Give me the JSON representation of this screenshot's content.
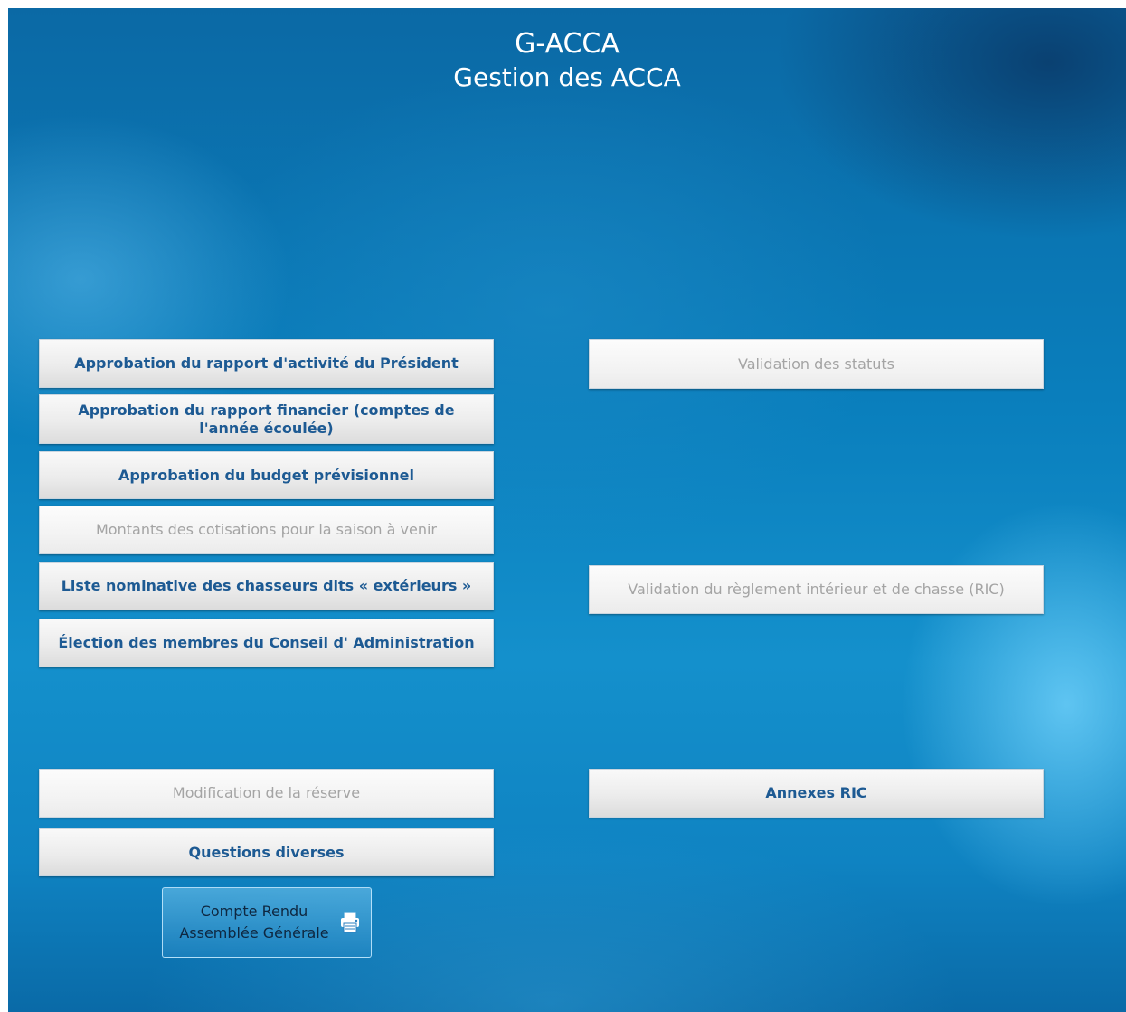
{
  "header": {
    "title": "G-ACCA",
    "subtitle": "Gestion des ACCA"
  },
  "left_buttons": [
    {
      "label": "Approbation du rapport d'activité du Président",
      "enabled": true
    },
    {
      "label": "Approbation du rapport financier (comptes de l'année écoulée)",
      "enabled": true
    },
    {
      "label": "Approbation du budget prévisionnel",
      "enabled": true
    },
    {
      "label": "Montants des cotisations pour la saison à venir",
      "enabled": false
    },
    {
      "label": "Liste nominative des chasseurs dits « extérieurs »",
      "enabled": true
    },
    {
      "label": "Élection des membres du Conseil d' Administration",
      "enabled": true
    },
    {
      "label": "Modification de la réserve",
      "enabled": false
    },
    {
      "label": "Questions diverses",
      "enabled": true
    }
  ],
  "right_buttons": [
    {
      "label": "Validation des statuts",
      "enabled": false
    },
    {
      "label": "Validation du règlement intérieur et de chasse (RIC)",
      "enabled": false
    },
    {
      "label": "Annexes RIC",
      "enabled": true
    }
  ],
  "report_button": {
    "line1": "Compte Rendu",
    "line2": "Assemblée Générale",
    "icon": "printer-icon"
  },
  "colors": {
    "button_text_enabled": "#1d5a93",
    "button_text_disabled": "#a4a4a4",
    "background": "#0a7fbd"
  }
}
